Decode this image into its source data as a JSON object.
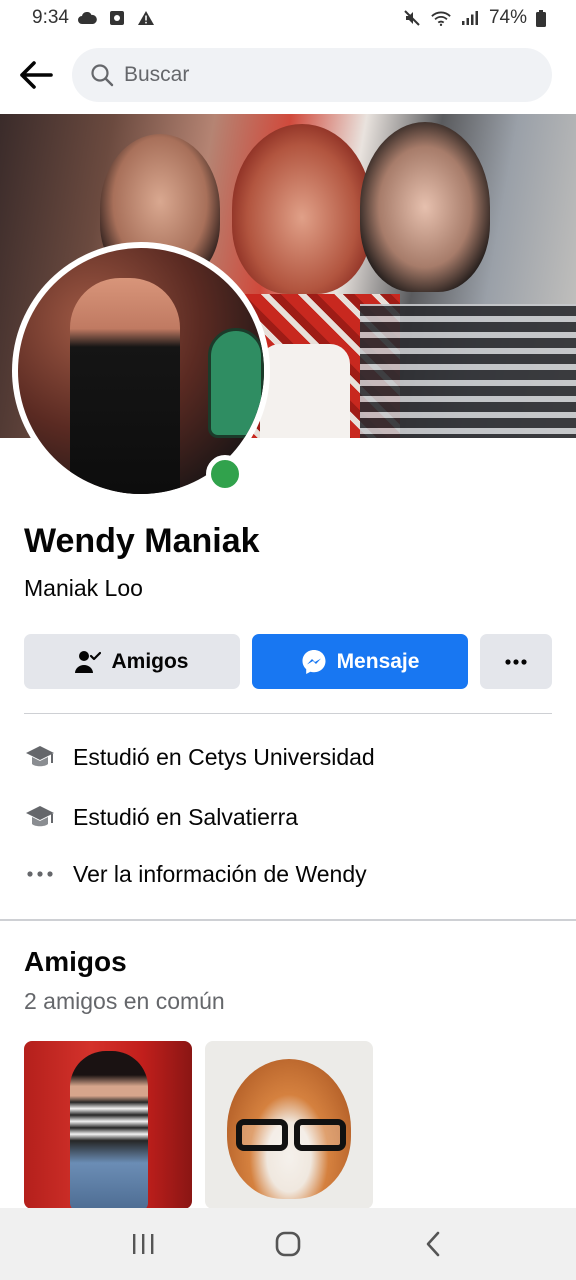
{
  "status_bar": {
    "time": "9:34",
    "battery": "74%",
    "left_icons": [
      "cloud-icon",
      "sd-card-icon",
      "alert-triangle-icon"
    ],
    "right_icons": [
      "mute-icon",
      "wifi-icon",
      "signal-icon",
      "battery-icon"
    ]
  },
  "header": {
    "search_placeholder": "Buscar"
  },
  "profile": {
    "name": "Wendy Maniak",
    "alternate_name": "Maniak Loo",
    "online": true
  },
  "actions": {
    "friends_label": "Amigos",
    "message_label": "Mensaje"
  },
  "details": [
    {
      "icon": "graduation-cap-icon",
      "text": "Estudió en Cetys Universidad"
    },
    {
      "icon": "graduation-cap-icon",
      "text": "Estudió en Salvatierra"
    },
    {
      "icon": "ellipsis-icon",
      "text": "Ver la información de Wendy"
    }
  ],
  "friends": {
    "title": "Amigos",
    "subtitle": "2 amigos en común"
  },
  "colors": {
    "primary": "#1877f2",
    "secondary_button": "#e4e6eb",
    "online": "#31a24c",
    "text": "#050505",
    "muted_text": "#65676b"
  }
}
